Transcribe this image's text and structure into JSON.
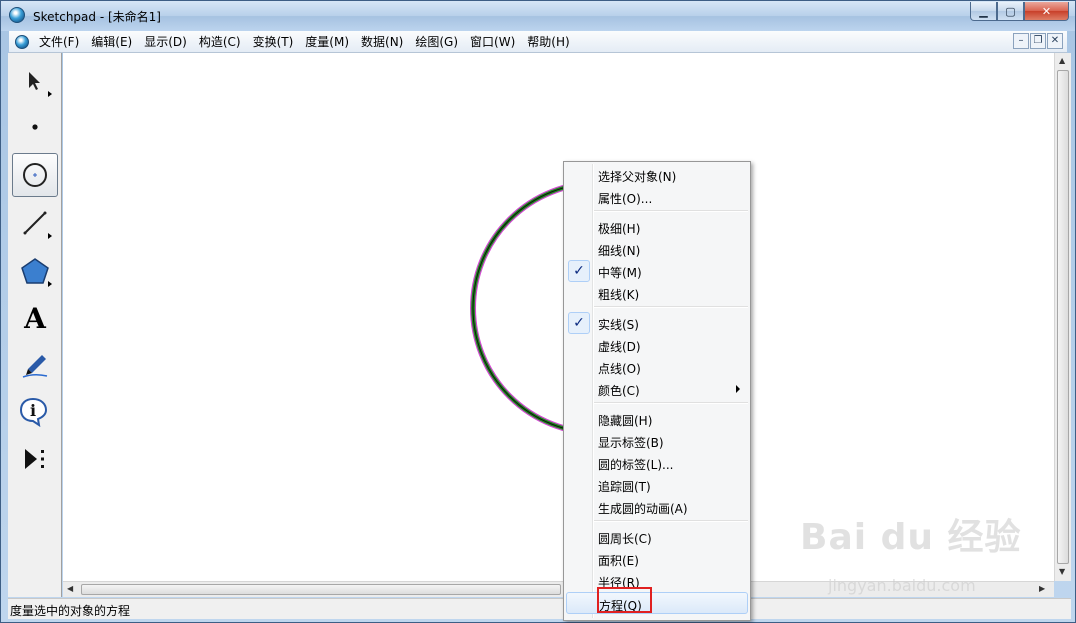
{
  "window": {
    "title": "Sketchpad  - [未命名1]",
    "minimize_glyph": "▁",
    "maximize_glyph": "▢",
    "close_glyph": "✕"
  },
  "menubar": {
    "items": [
      "文件(F)",
      "编辑(E)",
      "显示(D)",
      "构造(C)",
      "变换(T)",
      "度量(M)",
      "数据(N)",
      "绘图(G)",
      "窗口(W)",
      "帮助(H)"
    ],
    "mdi_minimize": "–",
    "mdi_restore": "❐",
    "mdi_close": "✕"
  },
  "toolbox": {
    "tools": [
      {
        "name": "arrow-select-tool",
        "icon": "arrow-icon",
        "active": false
      },
      {
        "name": "point-tool",
        "icon": "point-icon",
        "active": false
      },
      {
        "name": "compass-tool",
        "icon": "circle-icon",
        "active": true
      },
      {
        "name": "straightedge-tool",
        "icon": "line-segment-icon",
        "active": false
      },
      {
        "name": "polygon-tool",
        "icon": "pentagon-icon",
        "active": false
      },
      {
        "name": "text-tool",
        "icon": "text-a-icon",
        "active": false
      },
      {
        "name": "marker-tool",
        "icon": "marker-pen-icon",
        "active": false
      },
      {
        "name": "information-tool",
        "icon": "info-icon",
        "active": false
      },
      {
        "name": "custom-tool",
        "icon": "play-dots-icon",
        "active": false
      }
    ],
    "text_tool_glyph": "A",
    "info_glyph": "i"
  },
  "canvas": {
    "circle_colors": {
      "outer": "#d24bd2",
      "inner": "#1a8a1a",
      "core": "#111111"
    }
  },
  "context_menu": {
    "groups": [
      [
        {
          "label": "选择父对象(N)",
          "checked": false
        },
        {
          "label": "属性(O)...",
          "checked": false
        }
      ],
      [
        {
          "label": "极细(H)",
          "checked": false
        },
        {
          "label": "细线(N)",
          "checked": false
        },
        {
          "label": "中等(M)",
          "checked": true
        },
        {
          "label": "粗线(K)",
          "checked": false
        }
      ],
      [
        {
          "label": "实线(S)",
          "checked": true
        },
        {
          "label": "虚线(D)",
          "checked": false
        },
        {
          "label": "点线(O)",
          "checked": false
        },
        {
          "label": "颜色(C)",
          "checked": false,
          "submenu": true
        }
      ],
      [
        {
          "label": "隐藏圆(H)",
          "checked": false
        },
        {
          "label": "显示标签(B)",
          "checked": false
        },
        {
          "label": "圆的标签(L)...",
          "checked": false
        },
        {
          "label": "追踪圆(T)",
          "checked": false
        },
        {
          "label": "生成圆的动画(A)",
          "checked": false
        }
      ],
      [
        {
          "label": "圆周长(C)",
          "checked": false
        },
        {
          "label": "面积(E)",
          "checked": false
        },
        {
          "label": "半径(R)",
          "checked": false
        },
        {
          "label": "方程(Q)",
          "checked": false,
          "hover": true
        }
      ]
    ],
    "check_glyph": "✓",
    "highlight_color": "#e02020"
  },
  "statusbar": {
    "text": "度量选中的对象的方程"
  },
  "watermark": {
    "logo": "Bai du 经验",
    "url": "jingyan.baidu.com"
  }
}
